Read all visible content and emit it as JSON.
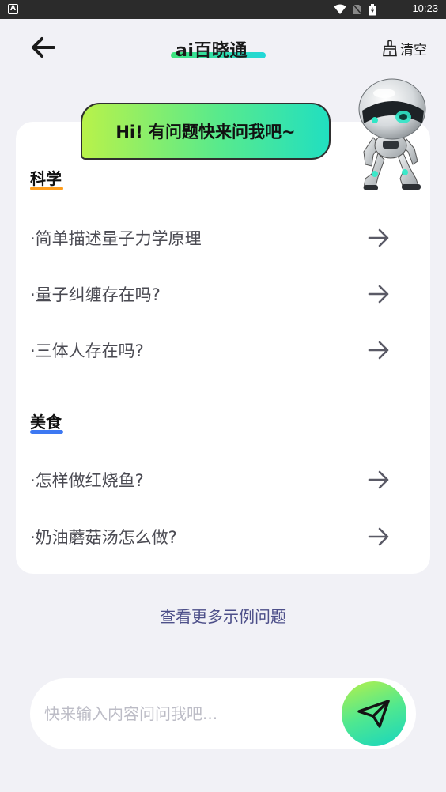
{
  "status_bar": {
    "time": "10:23",
    "app_icon_letter": "A"
  },
  "header": {
    "logo_text": "ai百晓通",
    "clear_label": "清空"
  },
  "bubble": {
    "greeting": "Hi! 有问题快来问我吧~"
  },
  "sections": [
    {
      "title": "科学",
      "underline_color": "#ff9d1c",
      "questions": [
        "·简单描述量子力学原理",
        "·量子纠缠存在吗?",
        "·三体人存在吗?"
      ]
    },
    {
      "title": "美食",
      "underline_color": "#3d78f2",
      "questions": [
        "·怎样做红烧鱼?",
        "·奶油蘑菇汤怎么做?"
      ]
    }
  ],
  "more_link": "查看更多示例问题",
  "input": {
    "placeholder": "快来输入内容问问我吧...",
    "value": ""
  },
  "colors": {
    "accent_start": "#b6f04a",
    "accent_end": "#17d5c0",
    "link": "#4d4f89",
    "background": "#f1f1f6"
  }
}
